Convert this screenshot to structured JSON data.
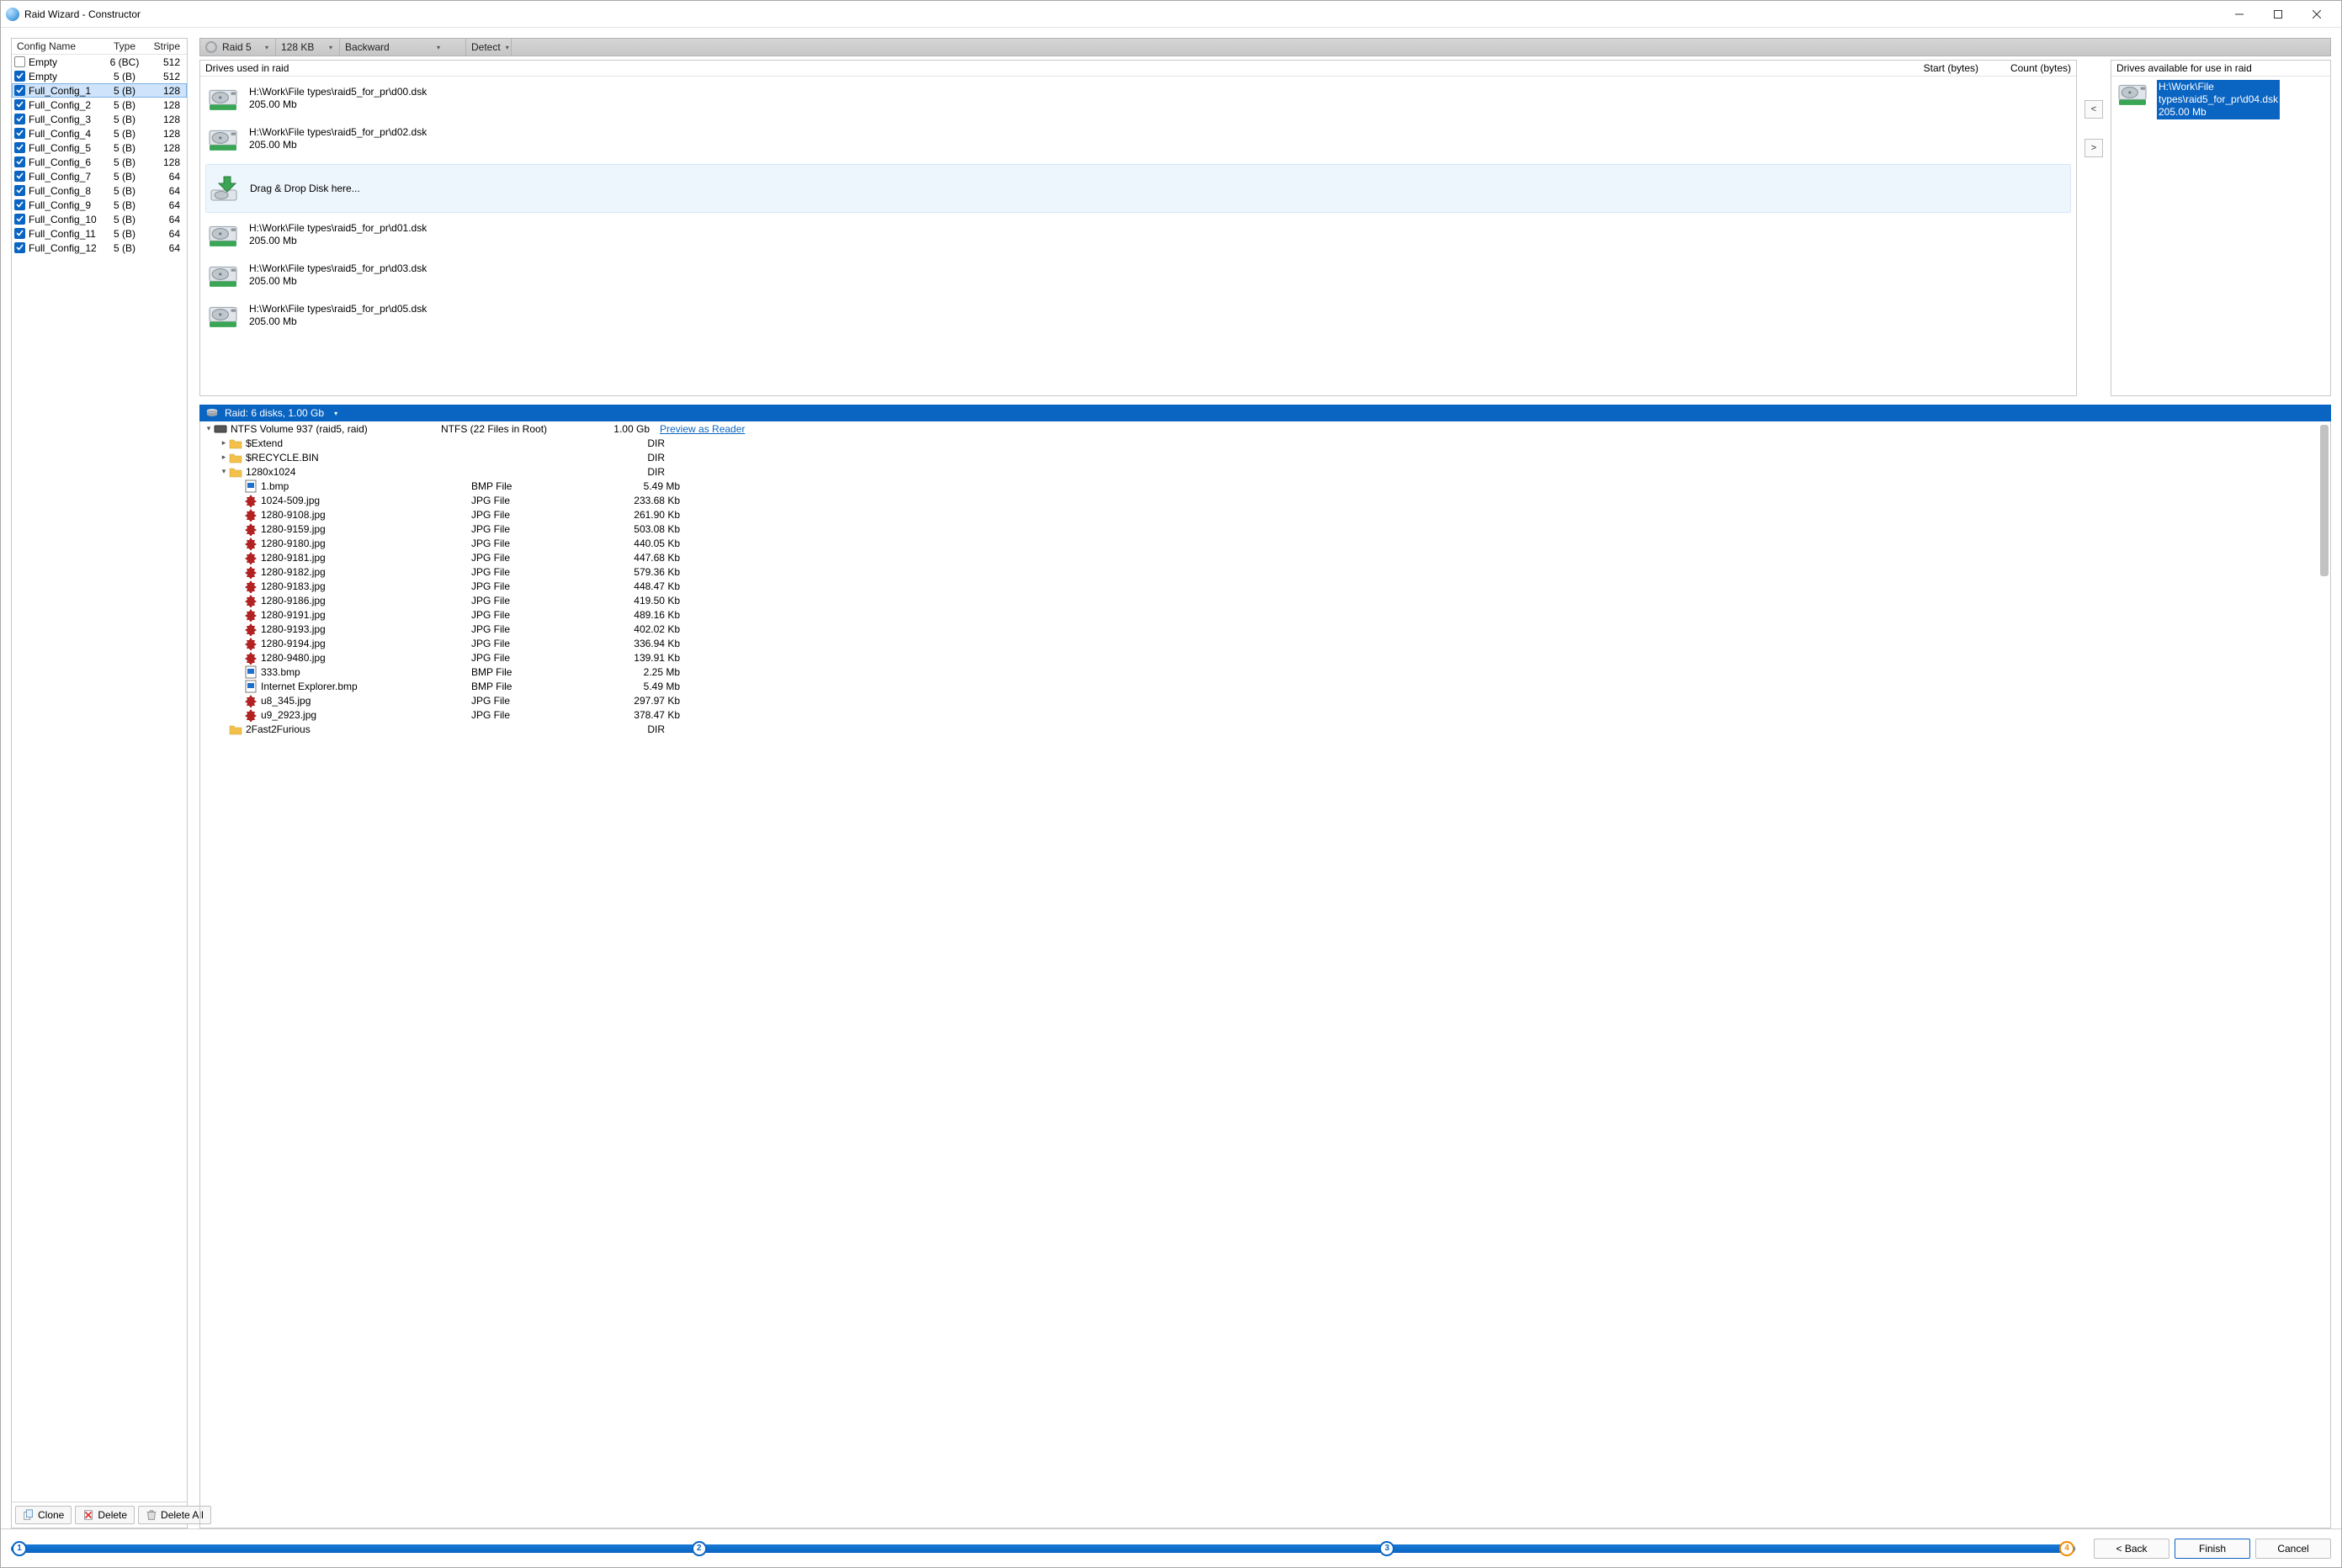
{
  "window": {
    "title": "Raid Wizard - Constructor"
  },
  "config_panel": {
    "headers": {
      "name": "Config Name",
      "type": "Type",
      "stripe": "Stripe"
    },
    "rows": [
      {
        "checked": false,
        "name": "Empty",
        "type": "6 (BC)",
        "stripe": "512",
        "selected": false
      },
      {
        "checked": true,
        "name": "Empty",
        "type": "5 (B)",
        "stripe": "512",
        "selected": false
      },
      {
        "checked": true,
        "name": "Full_Config_1",
        "type": "5 (B)",
        "stripe": "128",
        "selected": true
      },
      {
        "checked": true,
        "name": "Full_Config_2",
        "type": "5 (B)",
        "stripe": "128",
        "selected": false
      },
      {
        "checked": true,
        "name": "Full_Config_3",
        "type": "5 (B)",
        "stripe": "128",
        "selected": false
      },
      {
        "checked": true,
        "name": "Full_Config_4",
        "type": "5 (B)",
        "stripe": "128",
        "selected": false
      },
      {
        "checked": true,
        "name": "Full_Config_5",
        "type": "5 (B)",
        "stripe": "128",
        "selected": false
      },
      {
        "checked": true,
        "name": "Full_Config_6",
        "type": "5 (B)",
        "stripe": "128",
        "selected": false
      },
      {
        "checked": true,
        "name": "Full_Config_7",
        "type": "5 (B)",
        "stripe": "64",
        "selected": false
      },
      {
        "checked": true,
        "name": "Full_Config_8",
        "type": "5 (B)",
        "stripe": "64",
        "selected": false
      },
      {
        "checked": true,
        "name": "Full_Config_9",
        "type": "5 (B)",
        "stripe": "64",
        "selected": false
      },
      {
        "checked": true,
        "name": "Full_Config_10",
        "type": "5 (B)",
        "stripe": "64",
        "selected": false
      },
      {
        "checked": true,
        "name": "Full_Config_11",
        "type": "5 (B)",
        "stripe": "64",
        "selected": false
      },
      {
        "checked": true,
        "name": "Full_Config_12",
        "type": "5 (B)",
        "stripe": "64",
        "selected": false
      }
    ],
    "buttons": {
      "clone": "Clone",
      "delete": "Delete",
      "delete_all": "Delete All"
    }
  },
  "raid_toolbar": {
    "raid_type": "Raid 5",
    "stripe_size": "128 KB",
    "direction": "Backward",
    "detect": "Detect"
  },
  "drives_used": {
    "title": "Drives used in raid",
    "col_start": "Start (bytes)",
    "col_count": "Count (bytes)",
    "drop_hint": "Drag & Drop Disk here...",
    "items": [
      {
        "path": "H:\\Work\\File types\\raid5_for_pr\\d00.dsk",
        "size": "205.00 Mb"
      },
      {
        "path": "H:\\Work\\File types\\raid5_for_pr\\d02.dsk",
        "size": "205.00 Mb"
      },
      {
        "drop": true
      },
      {
        "path": "H:\\Work\\File types\\raid5_for_pr\\d01.dsk",
        "size": "205.00 Mb"
      },
      {
        "path": "H:\\Work\\File types\\raid5_for_pr\\d03.dsk",
        "size": "205.00 Mb"
      },
      {
        "path": "H:\\Work\\File types\\raid5_for_pr\\d05.dsk",
        "size": "205.00 Mb"
      }
    ]
  },
  "move_buttons": {
    "left": "<",
    "right": ">"
  },
  "drives_avail": {
    "title": "Drives available for use in raid",
    "items": [
      {
        "line1": "H:\\Work\\File",
        "line2": "types\\raid5_for_pr\\d04.dsk",
        "size": "205.00 Mb",
        "selected": true
      }
    ]
  },
  "raid_result": {
    "bar_label": "Raid: 6 disks, 1.00 Gb",
    "preview_link": "Preview as Reader",
    "root": {
      "name": "NTFS Volume 937 (raid5, raid)",
      "type": "NTFS (22 Files in Root)",
      "size": "1.00 Gb"
    },
    "tree": [
      {
        "depth": 1,
        "exp": ">",
        "icon": "folder",
        "name": "$Extend",
        "type": "",
        "size": "DIR"
      },
      {
        "depth": 1,
        "exp": ">",
        "icon": "folder",
        "name": "$RECYCLE.BIN",
        "type": "",
        "size": "DIR"
      },
      {
        "depth": 1,
        "exp": "v",
        "icon": "folder",
        "name": "1280x1024",
        "type": "",
        "size": "DIR"
      },
      {
        "depth": 2,
        "exp": "",
        "icon": "bmp",
        "name": "1.bmp",
        "type": "BMP File",
        "size": "5.49 Mb"
      },
      {
        "depth": 2,
        "exp": "",
        "icon": "jpg",
        "name": "1024-509.jpg",
        "type": "JPG File",
        "size": "233.68 Kb"
      },
      {
        "depth": 2,
        "exp": "",
        "icon": "jpg",
        "name": "1280-9108.jpg",
        "type": "JPG File",
        "size": "261.90 Kb"
      },
      {
        "depth": 2,
        "exp": "",
        "icon": "jpg",
        "name": "1280-9159.jpg",
        "type": "JPG File",
        "size": "503.08 Kb"
      },
      {
        "depth": 2,
        "exp": "",
        "icon": "jpg",
        "name": "1280-9180.jpg",
        "type": "JPG File",
        "size": "440.05 Kb"
      },
      {
        "depth": 2,
        "exp": "",
        "icon": "jpg",
        "name": "1280-9181.jpg",
        "type": "JPG File",
        "size": "447.68 Kb"
      },
      {
        "depth": 2,
        "exp": "",
        "icon": "jpg",
        "name": "1280-9182.jpg",
        "type": "JPG File",
        "size": "579.36 Kb"
      },
      {
        "depth": 2,
        "exp": "",
        "icon": "jpg",
        "name": "1280-9183.jpg",
        "type": "JPG File",
        "size": "448.47 Kb"
      },
      {
        "depth": 2,
        "exp": "",
        "icon": "jpg",
        "name": "1280-9186.jpg",
        "type": "JPG File",
        "size": "419.50 Kb"
      },
      {
        "depth": 2,
        "exp": "",
        "icon": "jpg",
        "name": "1280-9191.jpg",
        "type": "JPG File",
        "size": "489.16 Kb"
      },
      {
        "depth": 2,
        "exp": "",
        "icon": "jpg",
        "name": "1280-9193.jpg",
        "type": "JPG File",
        "size": "402.02 Kb"
      },
      {
        "depth": 2,
        "exp": "",
        "icon": "jpg",
        "name": "1280-9194.jpg",
        "type": "JPG File",
        "size": "336.94 Kb"
      },
      {
        "depth": 2,
        "exp": "",
        "icon": "jpg",
        "name": "1280-9480.jpg",
        "type": "JPG File",
        "size": "139.91 Kb"
      },
      {
        "depth": 2,
        "exp": "",
        "icon": "bmp",
        "name": "333.bmp",
        "type": "BMP File",
        "size": "2.25 Mb"
      },
      {
        "depth": 2,
        "exp": "",
        "icon": "bmp",
        "name": "Internet Explorer.bmp",
        "type": "BMP File",
        "size": "5.49 Mb"
      },
      {
        "depth": 2,
        "exp": "",
        "icon": "jpg",
        "name": "u8_345.jpg",
        "type": "JPG File",
        "size": "297.97 Kb"
      },
      {
        "depth": 2,
        "exp": "",
        "icon": "jpg",
        "name": "u9_2923.jpg",
        "type": "JPG File",
        "size": "378.47 Kb"
      },
      {
        "depth": 1,
        "exp": "",
        "icon": "folder",
        "name": "2Fast2Furious",
        "type": "",
        "size": "DIR"
      }
    ]
  },
  "footer": {
    "steps": [
      "1",
      "2",
      "3",
      "4"
    ],
    "current_step_index": 3,
    "back": "< Back",
    "finish": "Finish",
    "cancel": "Cancel"
  }
}
